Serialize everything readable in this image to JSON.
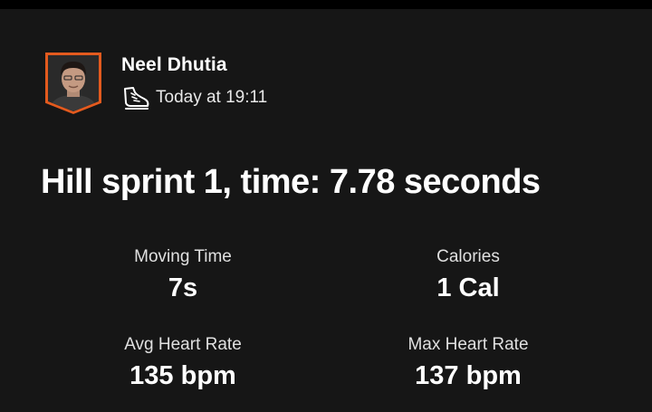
{
  "post": {
    "author_name": "Neel Dhutia",
    "timestamp": "Today at 19:11",
    "activity_icon": "running-shoe-icon",
    "title": "Hill sprint 1, time: 7.78 seconds"
  },
  "stats": [
    {
      "label": "Moving Time",
      "value": "7s"
    },
    {
      "label": "Calories",
      "value": "1 Cal"
    },
    {
      "label": "Avg Heart Rate",
      "value": "135 bpm"
    },
    {
      "label": "Max Heart Rate",
      "value": "137 bpm"
    }
  ],
  "colors": {
    "background": "#161616",
    "avatar_border": "#e35a1e",
    "text": "#ffffff"
  }
}
